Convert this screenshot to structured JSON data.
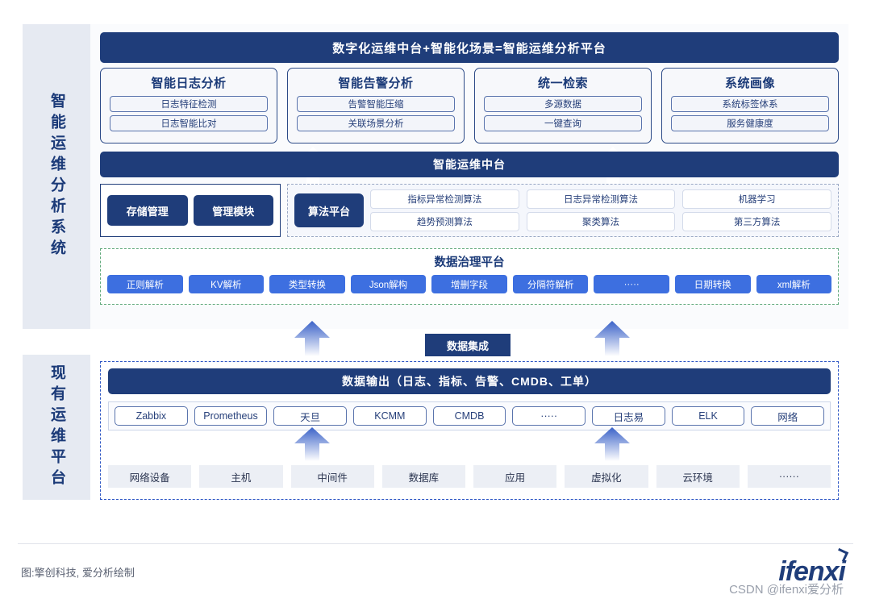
{
  "rails": {
    "upper": "智能运维分析系统",
    "lower": "现有运维平台"
  },
  "header": {
    "title": "数字化运维中台+智能化场景=智能运维分析平台"
  },
  "feature_cards": [
    {
      "title": "智能日志分析",
      "items": [
        "日志特征检测",
        "日志智能比对"
      ]
    },
    {
      "title": "智能告警分析",
      "items": [
        "告警智能压缩",
        "关联场景分析"
      ]
    },
    {
      "title": "统一检索",
      "items": [
        "多源数据",
        "一键查询"
      ]
    },
    {
      "title": "系统画像",
      "items": [
        "系统标签体系",
        "服务健康度"
      ]
    }
  ],
  "mid_platform": {
    "title": "智能运维中台",
    "storage_modules": [
      "存储管理",
      "管理模块"
    ],
    "algo_label": "算法平台",
    "algo_columns": [
      [
        "指标异常检测算法",
        "趋势预测算法"
      ],
      [
        "日志异常检测算法",
        "聚类算法"
      ],
      [
        "机器学习",
        "第三方算法"
      ]
    ]
  },
  "governance": {
    "title": "数据治理平台",
    "tags": [
      "正则解析",
      "KV解析",
      "类型转换",
      "Json解构",
      "增删字段",
      "分隔符解析",
      "·····",
      "日期转换",
      "xml解析"
    ]
  },
  "integration": {
    "label": "数据集成"
  },
  "lower_section": {
    "output_title": "数据输出（日志、指标、告警、CMDB、工单）",
    "tools": [
      "Zabbix",
      "Prometheus",
      "天旦",
      "KCMM",
      "CMDB",
      "·····",
      "日志易",
      "ELK",
      "网络"
    ],
    "infrastructure": [
      "网络设备",
      "主机",
      "中间件",
      "数据库",
      "应用",
      "虚拟化",
      "云环境",
      "······"
    ]
  },
  "footer": {
    "credit": "图:擎创科技, 爱分析绘制",
    "logo": "ifenxi",
    "watermark": "CSDN @ifenxi爱分析"
  },
  "colors": {
    "navy": "#1f3d7a",
    "tag_blue": "#3d6fe0",
    "rail_bg": "#e6eaf2",
    "gov_border": "#5fa87a",
    "lower_border": "#2d56c4"
  }
}
